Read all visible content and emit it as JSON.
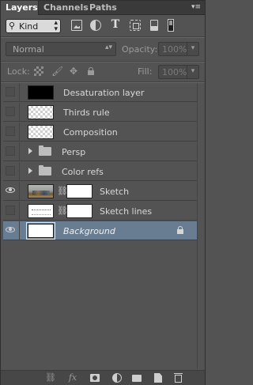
{
  "tabs": [
    {
      "label": "Layers",
      "active": true
    },
    {
      "label": "Channels",
      "active": false
    },
    {
      "label": "Paths",
      "active": false
    }
  ],
  "panel_menu_icon": "panel-menu-icon",
  "filter": {
    "kind_label": "Kind",
    "icons": [
      "image-filter-icon",
      "adjustment-filter-icon",
      "type-filter-icon",
      "shape-filter-icon",
      "smart-object-filter-icon"
    ]
  },
  "blend": {
    "mode": "Normal",
    "opacity_label": "Opacity:",
    "opacity_value": "100%"
  },
  "lock": {
    "label": "Lock:",
    "fill_label": "Fill:",
    "fill_value": "100%"
  },
  "layers": [
    {
      "name": "Desaturation layer",
      "visible": false,
      "kind": "pixel",
      "thumb": "black"
    },
    {
      "name": "Thirds rule",
      "visible": false,
      "kind": "pixel",
      "thumb": "transparent"
    },
    {
      "name": "Composition",
      "visible": false,
      "kind": "pixel",
      "thumb": "transparent"
    },
    {
      "name": "Persp",
      "visible": false,
      "kind": "group"
    },
    {
      "name": "Color refs",
      "visible": false,
      "kind": "group"
    },
    {
      "name": "Sketch",
      "visible": true,
      "kind": "masked",
      "thumb": "photo"
    },
    {
      "name": "Sketch lines",
      "visible": false,
      "kind": "masked",
      "thumb": "lines"
    },
    {
      "name": "Background",
      "visible": true,
      "kind": "background",
      "locked": true,
      "selected": true
    }
  ],
  "colors": {
    "panel_bg": "#535353",
    "selected_row": "#697d92"
  },
  "bottom_icons": [
    "link-layers-icon",
    "fx-icon",
    "add-mask-icon",
    "new-adjustment-icon",
    "new-group-icon",
    "new-layer-icon",
    "delete-layer-icon"
  ],
  "fx_label": "fx"
}
